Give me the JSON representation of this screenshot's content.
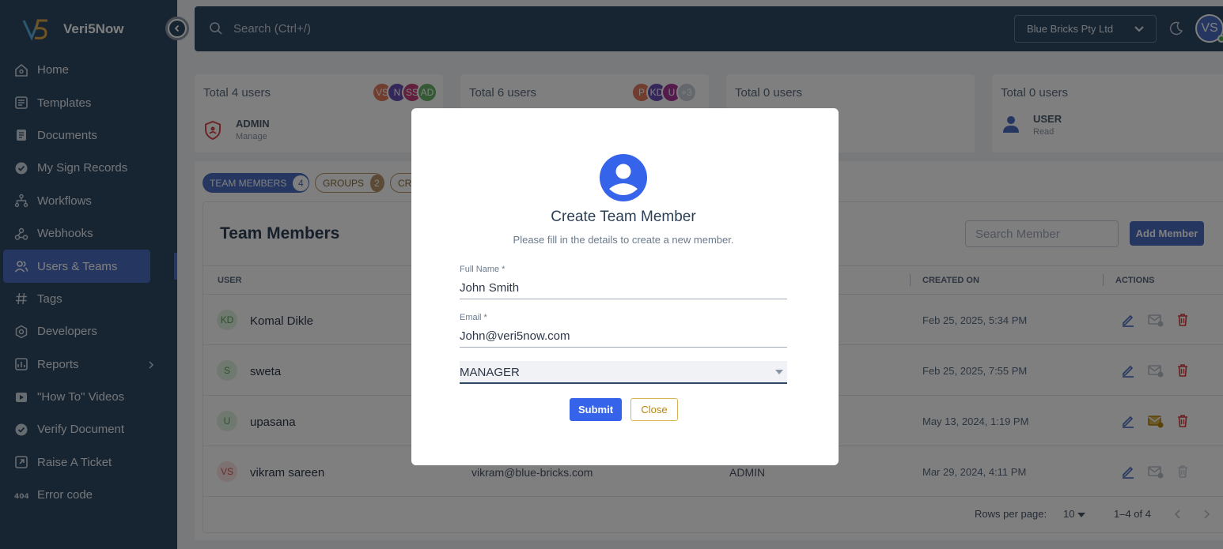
{
  "app": {
    "name": "Veri5Now"
  },
  "sidebar": {
    "items": [
      {
        "label": "Home"
      },
      {
        "label": "Templates"
      },
      {
        "label": "Documents"
      },
      {
        "label": "My Sign Records"
      },
      {
        "label": "Workflows"
      },
      {
        "label": "Webhooks"
      },
      {
        "label": "Users & Teams"
      },
      {
        "label": "Tags"
      },
      {
        "label": "Developers"
      },
      {
        "label": "Reports"
      },
      {
        "label": "\"How To\" Videos"
      },
      {
        "label": "Verify Document"
      },
      {
        "label": "Raise A Ticket"
      },
      {
        "label": "Error code"
      }
    ]
  },
  "topbar": {
    "search_placeholder": "Search (Ctrl+/)",
    "company": "Blue Bricks Pty Ltd",
    "avatar": "VS"
  },
  "cards": [
    {
      "total": "Total 4 users",
      "role": "ADMIN",
      "sub": "Manage",
      "avatars": [
        "VS",
        "N",
        "SS",
        "AD"
      ]
    },
    {
      "total": "Total 6 users",
      "avatars": [
        "P",
        "KD",
        "U",
        "+3"
      ]
    },
    {
      "total": "Total 0 users"
    },
    {
      "total": "Total 0 users",
      "role": "USER",
      "sub": "Read"
    }
  ],
  "tabs": [
    {
      "label": "TEAM MEMBERS",
      "count": "4"
    },
    {
      "label": "GROUPS",
      "count": "2"
    },
    {
      "label": "CR"
    }
  ],
  "team": {
    "title": "Team Members",
    "search_placeholder": "Search Member",
    "add_label": "Add Member",
    "columns": {
      "user": "USER",
      "created": "CREATED ON",
      "actions": "ACTIONS"
    },
    "rows": [
      {
        "initials": "KD",
        "name": "Komal Dikle",
        "email": "",
        "role": "",
        "created": "Feb 25, 2025, 5:34 PM"
      },
      {
        "initials": "S",
        "name": "sweta",
        "email": "",
        "role": "",
        "created": "Feb 25, 2025, 7:55 PM"
      },
      {
        "initials": "U",
        "name": "upasana",
        "email": "",
        "role": "",
        "created": "May 13, 2024, 1:19 PM"
      },
      {
        "initials": "VS",
        "name": "vikram sareen",
        "email": "vikram@blue-bricks.com",
        "role": "ADMIN",
        "created": "Mar 29, 2024, 4:11 PM"
      }
    ],
    "footer": {
      "rows_label": "Rows per page:",
      "rows_value": "10",
      "range": "1–4 of 4"
    }
  },
  "modal": {
    "title": "Create Team Member",
    "subtitle": "Please fill in the details to create a new member.",
    "full_name_label": "Full Name *",
    "full_name_value": "John Smith",
    "email_label": "Email *",
    "email_value": "John@veri5now.com",
    "role_value": "MANAGER",
    "submit_label": "Submit",
    "close_label": "Close"
  },
  "colors": {
    "sidebar": "#2f4863",
    "accent": "#4a6ec2",
    "submit": "#3563e9",
    "danger": "#d93a3a"
  }
}
